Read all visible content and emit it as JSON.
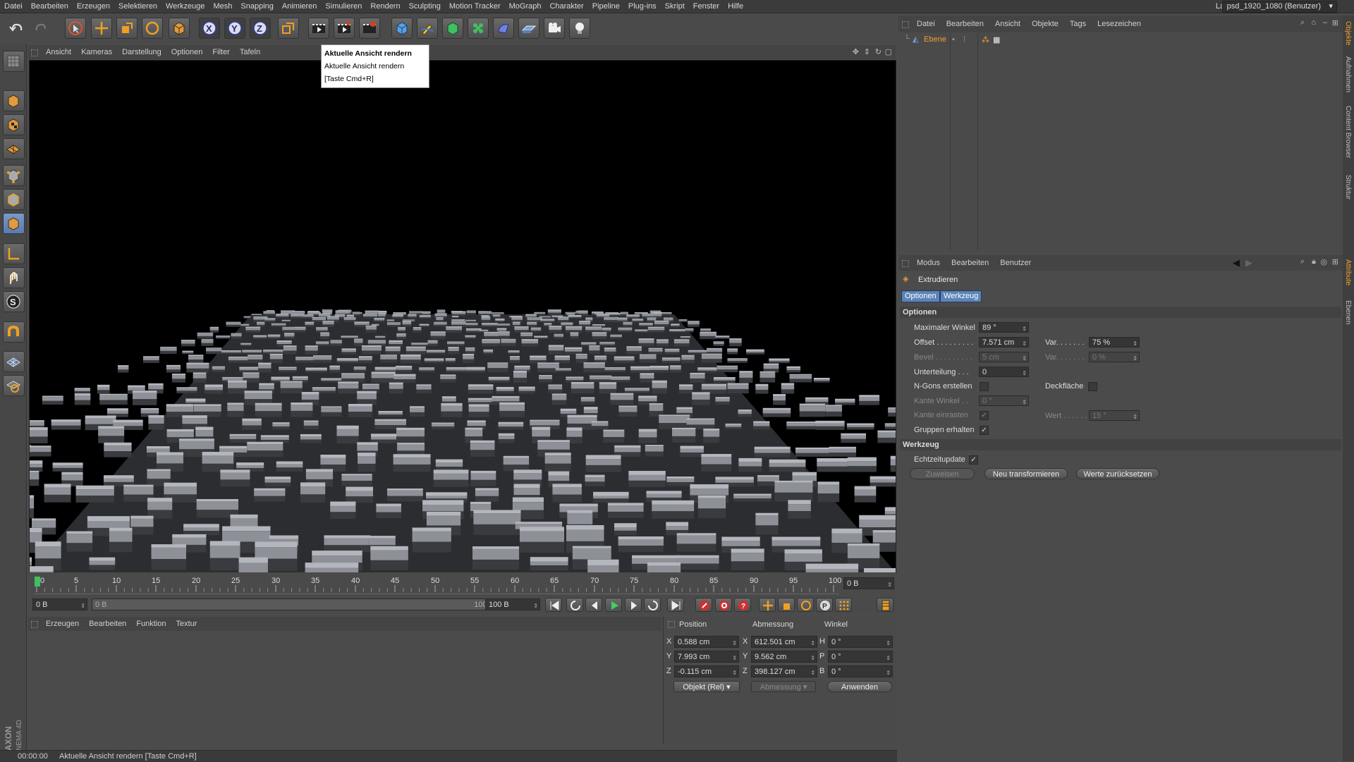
{
  "menubar": {
    "items": [
      "Datei",
      "Bearbeiten",
      "Erzeugen",
      "Selektieren",
      "Werkzeuge",
      "Mesh",
      "Snapping",
      "Animieren",
      "Simulieren",
      "Rendern",
      "Sculpting",
      "Motion Tracker",
      "MoGraph",
      "Charakter",
      "Pipeline",
      "Plug-ins",
      "Skript",
      "Fenster",
      "Hilfe"
    ],
    "layout_label": "Layout:",
    "layout_value": "psd_1920_1080 (Benutzer)"
  },
  "viewport": {
    "menu": [
      "Ansicht",
      "Kameras",
      "Darstellung",
      "Optionen",
      "Filter",
      "Tafeln"
    ]
  },
  "tooltip": {
    "title": "Aktuelle Ansicht rendern",
    "line2": "Aktuelle Ansicht rendern",
    "line3": "[Taste Cmd+R]"
  },
  "timeline": {
    "ticks": [
      "0",
      "5",
      "10",
      "15",
      "20",
      "25",
      "30",
      "35",
      "40",
      "45",
      "50",
      "55",
      "60",
      "65",
      "70",
      "75",
      "80",
      "85",
      "90",
      "95",
      "100"
    ],
    "current_frame": "0 B",
    "start": "0 B",
    "range_start": "0 B",
    "range_end": "100 B",
    "end": "100 B"
  },
  "material_panel": {
    "menu": [
      "Erzeugen",
      "Bearbeiten",
      "Funktion",
      "Textur"
    ]
  },
  "coordinates": {
    "headers": {
      "position": "Position",
      "size": "Abmessung",
      "rotation": "Winkel"
    },
    "rows": [
      {
        "axis": "X",
        "pos": "0.588 cm",
        "saxis": "X",
        "size": "612.501 cm",
        "raxis": "H",
        "rot": "0 °"
      },
      {
        "axis": "Y",
        "pos": "7.993 cm",
        "saxis": "Y",
        "size": "9.562 cm",
        "raxis": "P",
        "rot": "0 °"
      },
      {
        "axis": "Z",
        "pos": "-0.115 cm",
        "saxis": "Z",
        "size": "398.127 cm",
        "raxis": "B",
        "rot": "0 °"
      }
    ],
    "mode": "Objekt (Rel)",
    "size_mode": "Abmessung",
    "apply": "Anwenden"
  },
  "status": {
    "time": "00:00:00",
    "message": "Aktuelle Ansicht rendern [Taste Cmd+R]"
  },
  "objects": {
    "menu": [
      "Datei",
      "Bearbeiten",
      "Ansicht",
      "Objekte",
      "Tags",
      "Lesezeichen"
    ],
    "items": [
      {
        "name": "Ebene"
      }
    ]
  },
  "attributes": {
    "menu": [
      "Modus",
      "Bearbeiten",
      "Benutzer"
    ],
    "title": "Extrudieren",
    "tabs": [
      "Optionen",
      "Werkzeug"
    ],
    "section_options": "Optionen",
    "max_angle_label": "Maximaler Winkel",
    "max_angle": "89 °",
    "offset_label": "Offset . . . . . . . . .",
    "offset": "7.571 cm",
    "var_label": "Var. . . . . . .",
    "var_value": "75 %",
    "bevel_label": "Bevel . . . . . . . . .",
    "bevel": "5 cm",
    "var2_label": "Var. . . . . . .",
    "var2_value": "0 %",
    "subdiv_label": "Unterteilung . . .",
    "subdiv": "0",
    "ngons_label": "N-Gons erstellen",
    "cap_label": "Deckfläche",
    "edge_angle_label": "Kante Winkel . .",
    "edge_angle": "0 °",
    "edge_snap_label": "Kante einrasten",
    "wert_label": "Wert . . . . . .",
    "wert": "15 °",
    "groups_label": "Gruppen erhalten",
    "section_tool": "Werkzeug",
    "realtime_label": "Echtzeitupdate",
    "assign": "Zuweisen",
    "new_transform": "Neu transformieren",
    "reset": "Werte zurücksetzen"
  },
  "side_tabs": [
    "Objekte",
    "Aufnahmen",
    "Content Browser",
    "Struktur",
    "Attribute",
    "Ebenen"
  ],
  "colors": {
    "accent": "#f0a030",
    "tab_active": "#5a84b8"
  }
}
